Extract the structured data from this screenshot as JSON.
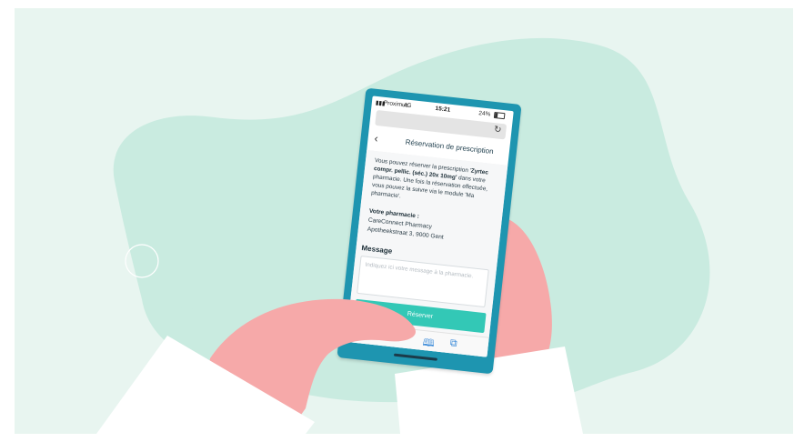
{
  "colors": {
    "background": "#e8f5f0",
    "blob": "#c9ebe0",
    "hand": "#f6a9a9",
    "sleeve": "#ffffff",
    "phone_frame": "#1e95b0",
    "accent_button": "#33c8b6"
  },
  "status_bar": {
    "carrier": "Proximus",
    "network": "4G",
    "time": "15:21",
    "battery": "24%",
    "signal_icon": "signal-bars-icon",
    "battery_icon": "battery-icon"
  },
  "browser": {
    "reload_icon_glyph": "↻"
  },
  "header": {
    "back_glyph": "‹",
    "title": "Réservation de prescription"
  },
  "intro": {
    "part1": "Vous pouvez réserver la prescription '",
    "product": "Zyrtec compr. pellic. (séc.) 20x 10mg'",
    "part2": " dans votre pharmacie. Une fois la réservation effectuée, vous pouvez la suivre via le module 'Ma pharmacie'."
  },
  "pharmacy": {
    "label": "Votre pharmacie :",
    "name": "CareConnect Pharmacy",
    "address": "Apotheekstraat 3, 9000 Gent"
  },
  "message": {
    "label": "Message",
    "placeholder": "Indiquez ici votre message à la pharmacie."
  },
  "submit": {
    "label": "Réserver"
  },
  "toolbar": {
    "share_glyph": "⇪",
    "bookmarks_glyph": "🕮",
    "tabs_glyph": "⧉"
  }
}
